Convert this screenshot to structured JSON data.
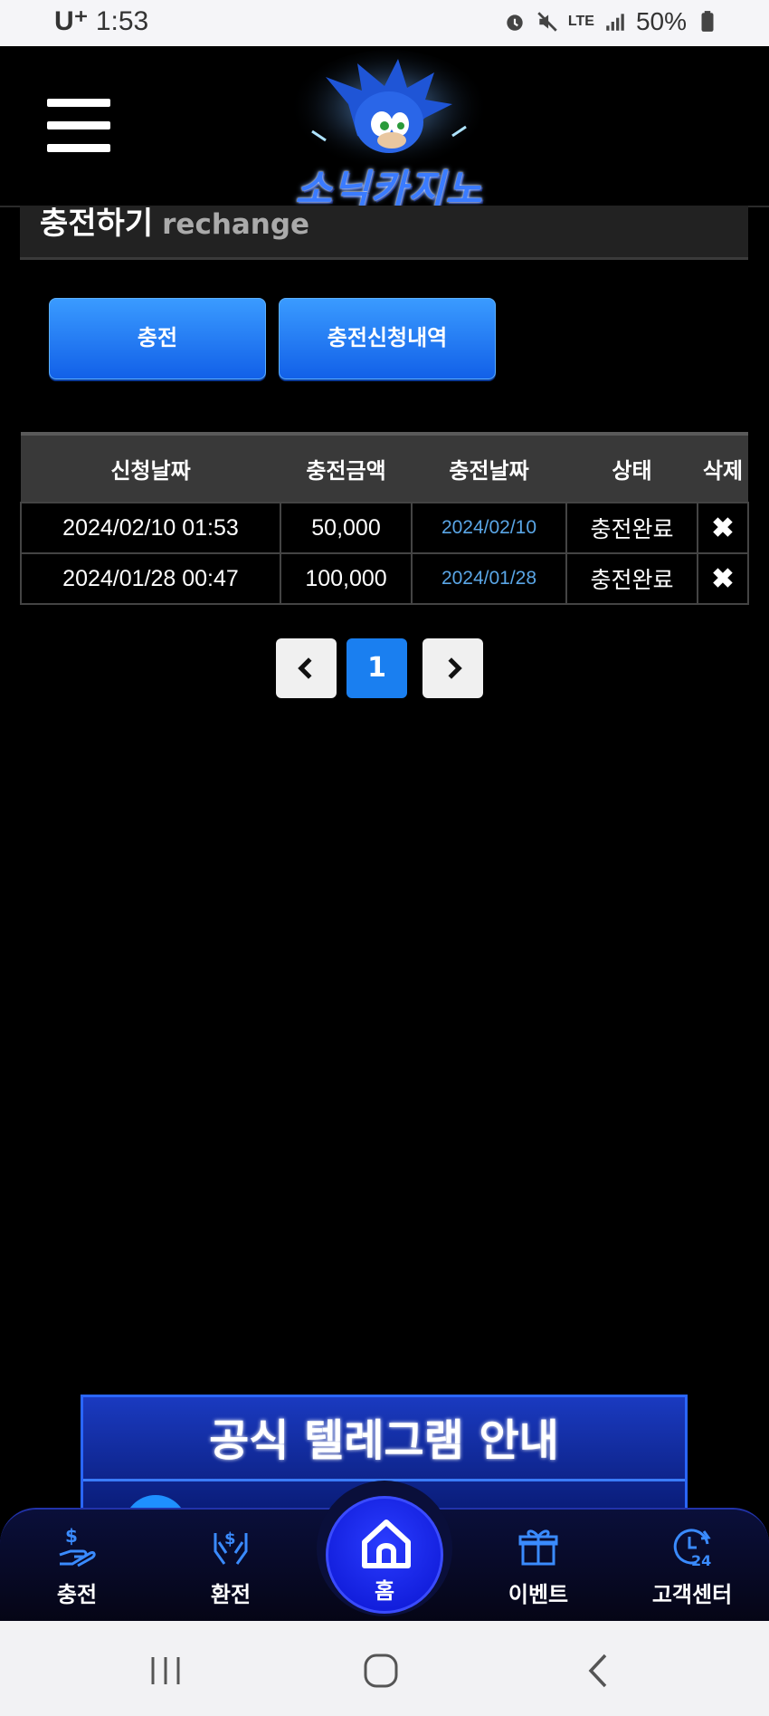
{
  "status_bar": {
    "carrier": "U⁺",
    "time": "1:53",
    "network": "LTE",
    "battery": "50%"
  },
  "header": {
    "logo_text": "소닉카지노"
  },
  "page": {
    "title": "충전하기",
    "subtitle": "rechange"
  },
  "tabs": [
    {
      "label": "충전"
    },
    {
      "label": "충전신청내역"
    }
  ],
  "table": {
    "columns": [
      "신청날짜",
      "충전금액",
      "충전날짜",
      "상태",
      "삭제"
    ],
    "rows": [
      {
        "requested": "2024/02/10 01:53",
        "amount": "50,000",
        "charged": "2024/02/10",
        "status": "충전완료",
        "delete": "✖"
      },
      {
        "requested": "2024/01/28 00:47",
        "amount": "100,000",
        "charged": "2024/01/28",
        "status": "충전완료",
        "delete": "✖"
      }
    ]
  },
  "pagination": {
    "prev": "‹",
    "current": "1",
    "next": "›"
  },
  "banner": {
    "title": "공식 텔레그램 안내"
  },
  "bottom_nav": {
    "items": [
      {
        "label": "충전",
        "icon": "deposit-icon"
      },
      {
        "label": "환전",
        "icon": "withdraw-icon"
      },
      {
        "label": "홈",
        "icon": "home-icon"
      },
      {
        "label": "이벤트",
        "icon": "gift-icon"
      },
      {
        "label": "고객센터",
        "icon": "support-24-icon"
      }
    ]
  },
  "colors": {
    "accent_blue": "#1a7ff0",
    "nav_blue": "#0a14d0",
    "date_blue": "#5aa6e6"
  }
}
